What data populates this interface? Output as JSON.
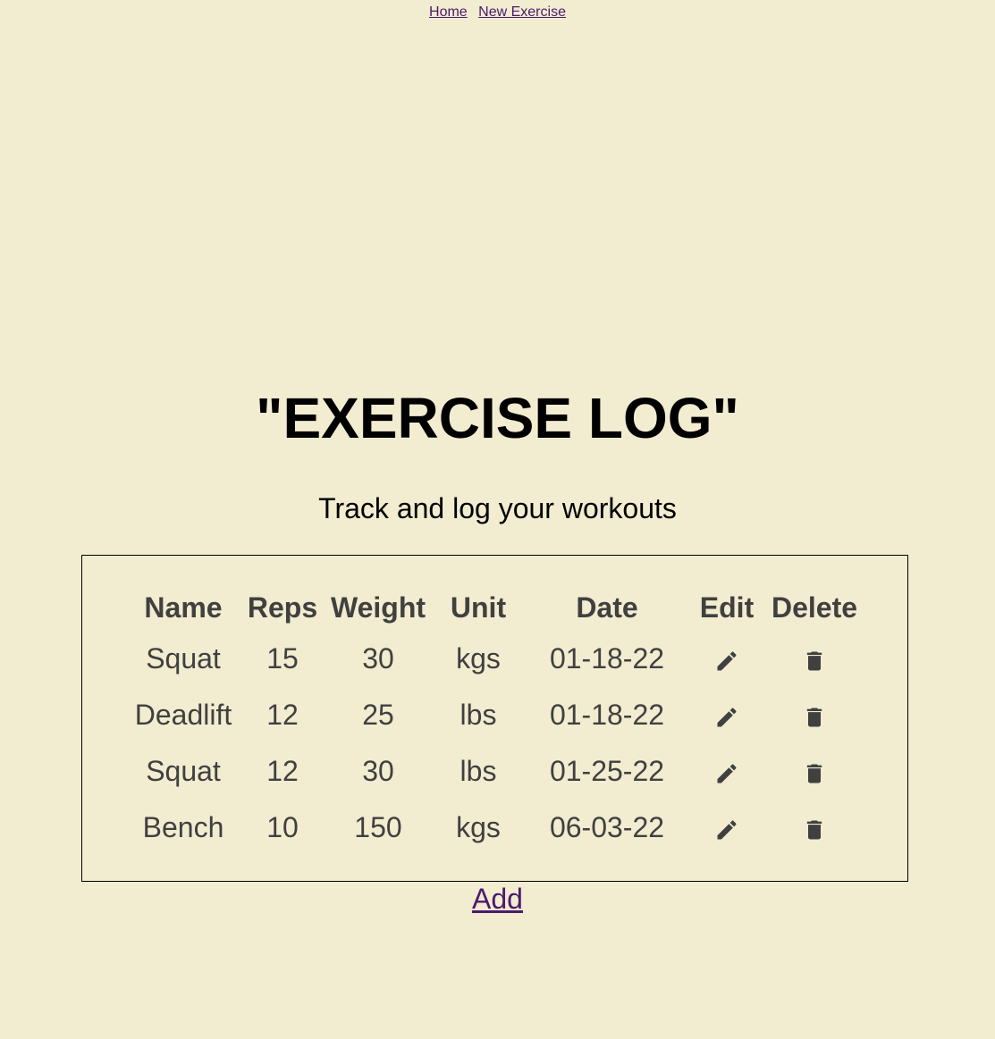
{
  "nav": {
    "home_label": "Home",
    "new_exercise_label": "New Exercise"
  },
  "page": {
    "title": "\"EXERCISE LOG\"",
    "subtitle": "Track and log your workouts",
    "add_label": "Add"
  },
  "table": {
    "headers": [
      "Name",
      "Reps",
      "Weight",
      "Unit",
      "Date",
      "Edit",
      "Delete"
    ],
    "rows": [
      {
        "name": "Squat",
        "reps": "15",
        "weight": "30",
        "unit": "kgs",
        "date": "01-18-22"
      },
      {
        "name": "Deadlift",
        "reps": "12",
        "weight": "25",
        "unit": "lbs",
        "date": "01-18-22"
      },
      {
        "name": "Squat",
        "reps": "12",
        "weight": "30",
        "unit": "lbs",
        "date": "01-25-22"
      },
      {
        "name": "Bench",
        "reps": "10",
        "weight": "150",
        "unit": "kgs",
        "date": "06-03-22"
      }
    ],
    "edit_icon": "pencil-icon",
    "delete_icon": "trash-icon"
  },
  "colors": {
    "background": "#f2ecd0",
    "link": "#4b1a6e",
    "table_text": "#404040"
  }
}
